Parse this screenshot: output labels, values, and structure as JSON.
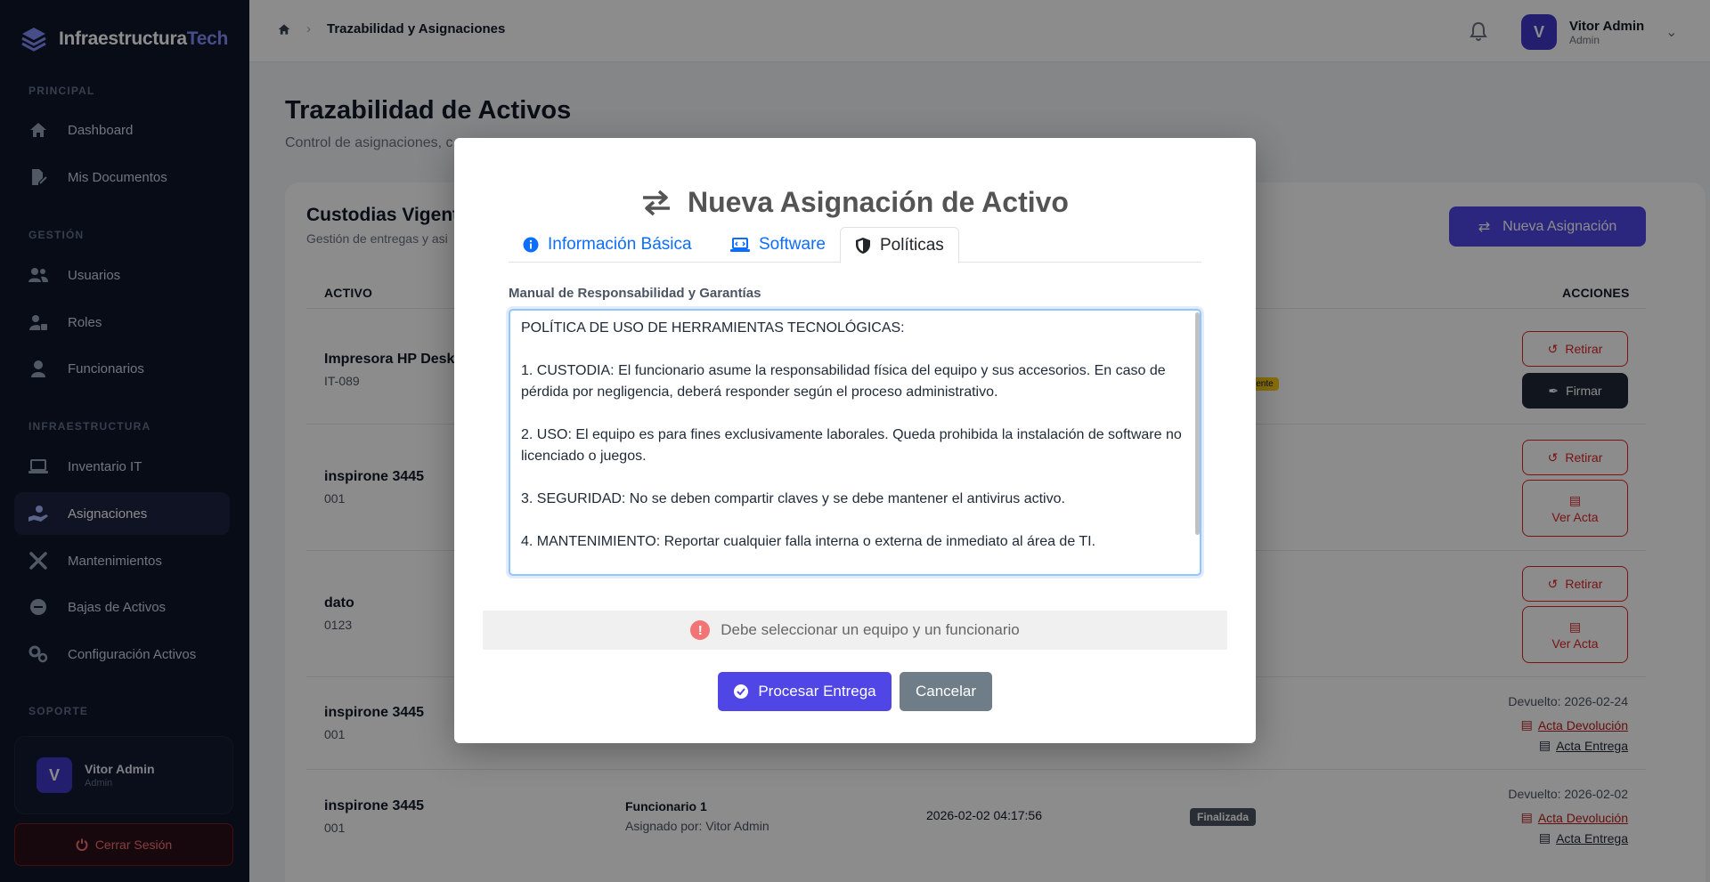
{
  "brand": {
    "name_main": "Infraestructura",
    "name_accent": "Tech"
  },
  "sidebar": {
    "sections": [
      "PRINCIPAL",
      "GESTIÓN",
      "INFRAESTRUCTURA",
      "SOPORTE"
    ],
    "items": [
      {
        "label": "Dashboard",
        "icon": "home-icon"
      },
      {
        "label": "Mis Documentos",
        "icon": "file-signature-icon"
      },
      {
        "label": "Usuarios",
        "icon": "users-icon"
      },
      {
        "label": "Roles",
        "icon": "user-lock-icon"
      },
      {
        "label": "Funcionarios",
        "icon": "user-icon"
      },
      {
        "label": "Inventario IT",
        "icon": "laptop-icon"
      },
      {
        "label": "Asignaciones",
        "icon": "hand-holding-icon",
        "active": true
      },
      {
        "label": "Mantenimientos",
        "icon": "tools-icon"
      },
      {
        "label": "Bajas de Activos",
        "icon": "minus-circle-icon"
      },
      {
        "label": "Configuración Activos",
        "icon": "cogs-icon"
      }
    ],
    "user": {
      "initial": "V",
      "name": "Vitor Admin",
      "role": "Admin"
    },
    "logout_label": "Cerrar Sesión"
  },
  "topbar": {
    "breadcrumb": "Trazabilidad y Asignaciones",
    "user": {
      "initial": "V",
      "name": "Vitor Admin",
      "role": "Admin"
    }
  },
  "page": {
    "title": "Trazabilidad de Activos",
    "subtitle": "Control de asignaciones, c",
    "card_title": "Custodias Vigente",
    "card_subtitle": "Gestión de entregas y asi",
    "new_button": "Nueva Asignación",
    "col_asset": "ACTIVO",
    "col_actions": "ACCIONES",
    "badge_pending": "iente",
    "rows": [
      {
        "name": "Impresora HP Desk",
        "code": "IT-089"
      },
      {
        "name": "inspirone 3445",
        "code": "001"
      },
      {
        "name": "dato",
        "code": "0123"
      },
      {
        "name": "inspirone 3445",
        "code": "001",
        "returned": "Devuelto: 2026-02-24"
      },
      {
        "name": "inspirone 3445",
        "code": "001",
        "returned": "Devuelto: 2026-02-02",
        "funcionario": "Funcionario 1",
        "assigned_by": "Asignado por: Vitor Admin",
        "date": "2026-02-02 04:17:56",
        "status": "Finalizada"
      }
    ],
    "actions": {
      "retirar": "Retirar",
      "firmar": "Firmar",
      "ver_acta": "Ver Acta",
      "acta_devolucion": "Acta Devolución",
      "acta_entrega": "Acta Entrega"
    }
  },
  "modal": {
    "title": "Nueva Asignación de Activo",
    "tabs": [
      {
        "label": "Información Básica",
        "icon": "info-circle-icon"
      },
      {
        "label": "Software",
        "icon": "laptop-code-icon"
      },
      {
        "label": "Políticas",
        "icon": "shield-icon",
        "active": true
      }
    ],
    "field_label": "Manual de Responsabilidad y Garantías",
    "policy_text": "POLÍTICA DE USO DE HERRAMIENTAS TECNOLÓGICAS:\n\n1. CUSTODIA: El funcionario asume la responsabilidad física del equipo y sus accesorios. En caso de pérdida por negligencia, deberá responder según el proceso administrativo.\n\n2. USO: El equipo es para fines exclusivamente laborales. Queda prohibida la instalación de software no licenciado o juegos.\n\n3. SEGURIDAD: No se deben compartir claves y se debe mantener el antivirus activo.\n\n4. MANTENIMIENTO: Reportar cualquier falla interna o externa de inmediato al área de TI.",
    "validation": "Debe seleccionar un equipo y un funcionario",
    "process_button": "Procesar Entrega",
    "cancel_button": "Cancelar"
  }
}
